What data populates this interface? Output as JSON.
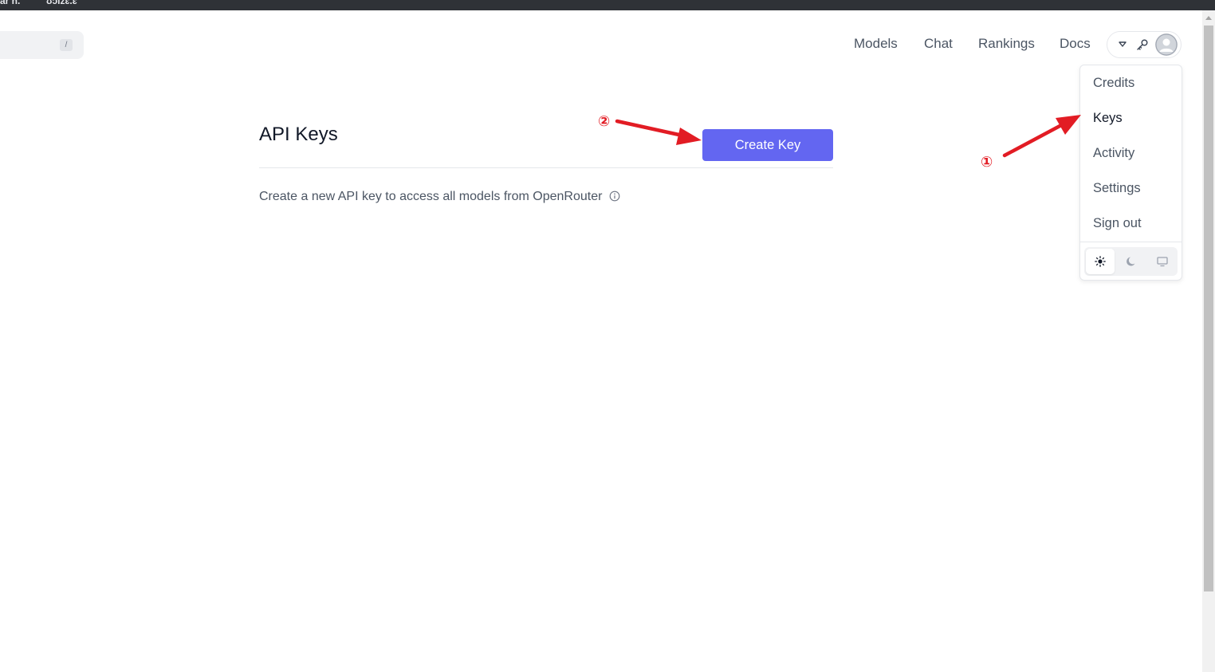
{
  "browser": {
    "tab_fragment_left": "ar n.",
    "tab_fragment_right": "ʊɔlzɛ.ɛ"
  },
  "search": {
    "shortcut_key": "/"
  },
  "nav": {
    "items": [
      "Models",
      "Chat",
      "Rankings",
      "Docs"
    ]
  },
  "account_menu": {
    "items": [
      "Credits",
      "Keys",
      "Activity",
      "Settings",
      "Sign out"
    ],
    "active_item": "Keys",
    "theme_options": [
      "sun-icon",
      "moon-icon",
      "monitor-icon"
    ],
    "selected_theme": "sun-icon"
  },
  "page": {
    "title": "API Keys",
    "create_button": "Create Key",
    "description": "Create a new API key to access all models from OpenRouter"
  },
  "annotations": {
    "step1": "①",
    "step2": "②",
    "color": "#e21c24"
  },
  "colors": {
    "accent": "#6366f1"
  }
}
